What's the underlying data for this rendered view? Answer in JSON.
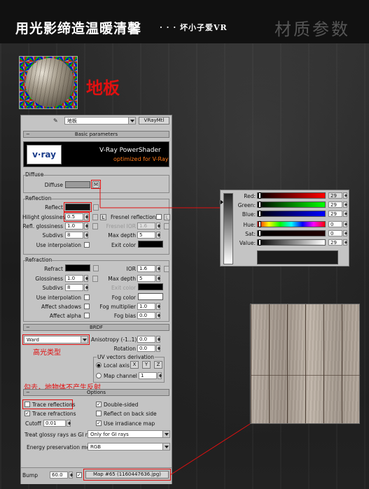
{
  "header": {
    "title": "用光影缔造温暖清馨",
    "subtitle": "· · · 坏小子爱VR",
    "brand": "材质参数"
  },
  "material": {
    "name": "地板",
    "combo_name": "地板",
    "type_label": "VRayMtl"
  },
  "rollouts": {
    "basic": "Basic parameters",
    "brdf": "BRDF",
    "options": "Options"
  },
  "vray_banner": {
    "logo_text": "v·ray",
    "line1": "V-Ray PowerShader",
    "line2": "optimized for V-Ray"
  },
  "diffuse": {
    "group": "Diffuse",
    "label": "Diffuse",
    "map_button": "M"
  },
  "reflection": {
    "group": "Reflection",
    "reflect_label": "Reflect",
    "hilight_label": "Hilight glossiness",
    "hilight_value": "0.5",
    "lock_button": "L",
    "refl_gloss_label": "Refl. glossiness",
    "refl_gloss_value": "1.0",
    "subdivs_label": "Subdivs",
    "subdivs_value": "8",
    "interp_label": "Use interpolation",
    "fresnel_label": "Fresnel reflections",
    "fresnel_lock": "L",
    "fresnel_ior_label": "Fresnel IOR",
    "fresnel_ior_value": "1.6",
    "max_depth_label": "Max depth",
    "max_depth_value": "5",
    "exit_color_label": "Exit color"
  },
  "refraction": {
    "group": "Refraction",
    "refract_label": "Refract",
    "ior_label": "IOR",
    "ior_value": "1.6",
    "gloss_label": "Glossiness",
    "gloss_value": "1.0",
    "max_depth_label": "Max depth",
    "max_depth_value": "5",
    "subdivs_label": "Subdivs",
    "subdivs_value": "8",
    "exit_color_label": "Exit color",
    "interp_label": "Use interpolation",
    "fog_color_label": "Fog color",
    "shadows_label": "Affect shadows",
    "fog_mult_label": "Fog multiplier",
    "fog_mult_value": "1.0",
    "alpha_label": "Affect alpha",
    "fog_bias_label": "Fog bias",
    "fog_bias_value": "0.0"
  },
  "brdf": {
    "type": "Ward",
    "anisotropy_label": "Anisotropy (-1..1)",
    "anisotropy_value": "0.0",
    "rotation_label": "Rotation",
    "rotation_value": "0.0",
    "uv_group": "UV vectors derivation",
    "local_axis_label": "Local axis",
    "axis_x": "X",
    "axis_y": "Y",
    "axis_z": "Z",
    "map_channel_label": "Map channel",
    "map_channel_value": "1"
  },
  "options": {
    "trace_reflections": "Trace reflections",
    "double_sided": "Double-sided",
    "trace_refractions": "Trace refractions",
    "reflect_back": "Reflect on back side",
    "cutoff_label": "Cutoff",
    "cutoff_value": "0.01",
    "use_irradiance": "Use irradiance map",
    "gi_label": "Treat glossy rays as GI rays:",
    "gi_value": "Only for GI rays",
    "energy_label": "Energy preservation mode:",
    "energy_value": "RGB"
  },
  "bump": {
    "label": "Bump",
    "value": "60.0",
    "map": "Map #65 (1160447636.jpg)"
  },
  "annotations": {
    "highlight_type": "高光类型",
    "trace_note": "勾去，地物体不产生反射"
  },
  "color_picker": {
    "red_label": "Red:",
    "red_value": "29",
    "green_label": "Green:",
    "green_value": "29",
    "blue_label": "Blue:",
    "blue_value": "29",
    "hue_label": "Hue:",
    "hue_value": "0",
    "sat_label": "Sat:",
    "sat_value": "0",
    "value_label": "Value:",
    "value_value": "29"
  },
  "colors": {
    "accent_red": "#e01010",
    "diffuse_swatch": "#9a9a9a",
    "picker_color": "#1d1d1d"
  }
}
